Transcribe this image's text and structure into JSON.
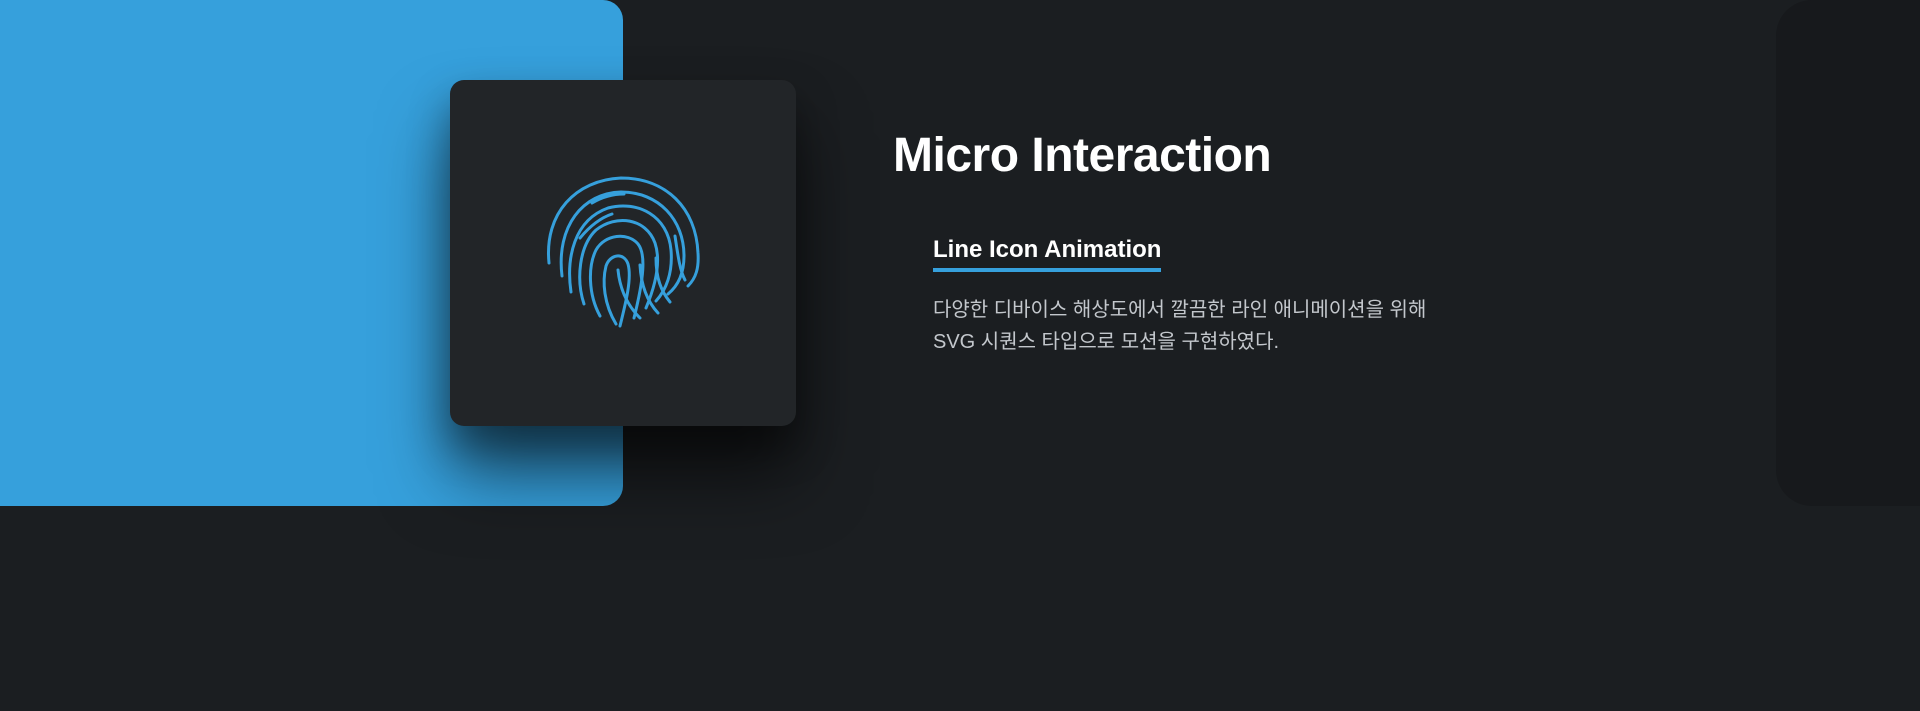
{
  "colors": {
    "accent": "#36a0dc",
    "background": "#1b1e21",
    "card": "#222528"
  },
  "icon": {
    "name": "fingerprint-icon"
  },
  "section": {
    "title": "Micro Interaction",
    "subtitle": "Line Icon Animation",
    "description_lines": [
      "다양한 디바이스 해상도에서 깔끔한 라인 애니메이션을 위해",
      "SVG 시퀀스 타입으로 모션을 구현하였다."
    ]
  }
}
